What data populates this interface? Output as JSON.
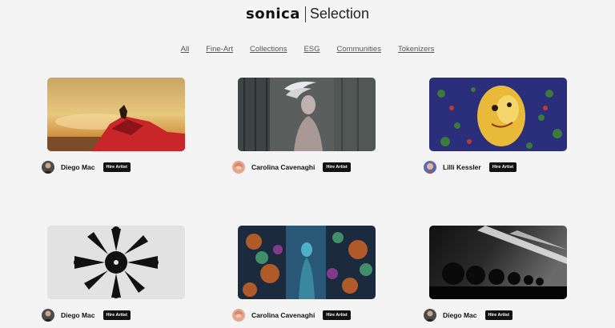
{
  "header": {
    "logo": "sonica",
    "page_title": "Selection"
  },
  "nav": {
    "items": [
      "All",
      "Fine-Art",
      "Collections",
      "ESG",
      "Communities",
      "Tokenizers"
    ]
  },
  "cards": [
    {
      "artist_name": "Diego Mac",
      "hire_label": "Hire Artist",
      "artwork": "red-dress-desert-sunset"
    },
    {
      "artist_name": "Carolina Cavenaghi",
      "hire_label": "Hire Artist",
      "artwork": "feathered-figure-industrial"
    },
    {
      "artist_name": "Lilli Kessler",
      "hire_label": "Hire Artist",
      "artwork": "psychedelic-yellow-face"
    },
    {
      "artist_name": "Diego Mac",
      "hire_label": "Hire Artist",
      "artwork": "black-starburst-silhouettes"
    },
    {
      "artist_name": "Carolina Cavenaghi",
      "hire_label": "Hire Artist",
      "artwork": "neon-forest-figure"
    },
    {
      "artist_name": "Diego Mac",
      "hire_label": "Hire Artist",
      "artwork": "dark-tunnel-light"
    }
  ]
}
